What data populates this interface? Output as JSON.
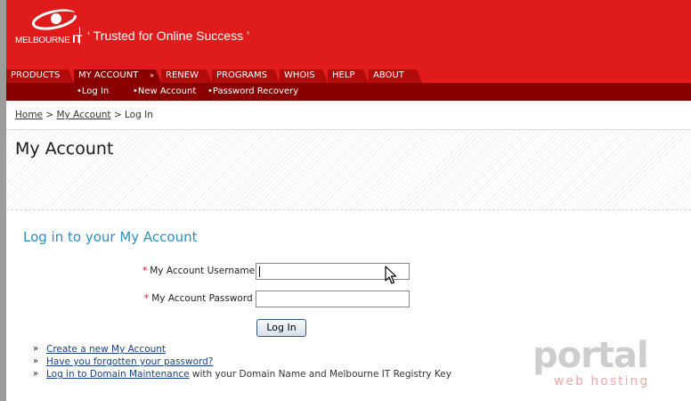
{
  "brand": {
    "logo_melbourne": "MELBOURNE",
    "logo_it": "IT",
    "tagline": "‘ Trusted for Online Success ’",
    "accent_color": "#e01b1b",
    "dark_red": "#8a0000"
  },
  "nav": {
    "tabs": [
      {
        "label": "PRODUCTS"
      },
      {
        "label": "MY ACCOUNT",
        "active": true,
        "arrow": "»"
      },
      {
        "label": "RENEW"
      },
      {
        "label": "PROGRAMS"
      },
      {
        "label": "WHOIS"
      },
      {
        "label": "HELP"
      },
      {
        "label": "ABOUT"
      }
    ],
    "sub_items": [
      {
        "label": "•Log In"
      },
      {
        "label": "•New Account"
      },
      {
        "label": "•Password Recovery"
      }
    ]
  },
  "breadcrumb": {
    "home": "Home",
    "sep1": " > ",
    "my_account": "My Account",
    "sep2": " > ",
    "current": "Log In"
  },
  "page": {
    "title": "My Account",
    "section_title": "Log in to your My Account"
  },
  "form": {
    "required_marker": "*",
    "username_label": "My Account Username",
    "username_value": "",
    "password_label": "My Account Password",
    "password_value": "",
    "submit_label": "Log In"
  },
  "links": {
    "bullet": "»",
    "create_account": "Create a new My Account",
    "forgot_password": "Have you forgotten your password?",
    "domain_maintenance": "Log in to Domain Maintenance",
    "domain_maintenance_suffix": " with your Domain Name and Melbourne IT Registry Key"
  },
  "watermark": {
    "main": "portal",
    "sub": "web hosting"
  }
}
